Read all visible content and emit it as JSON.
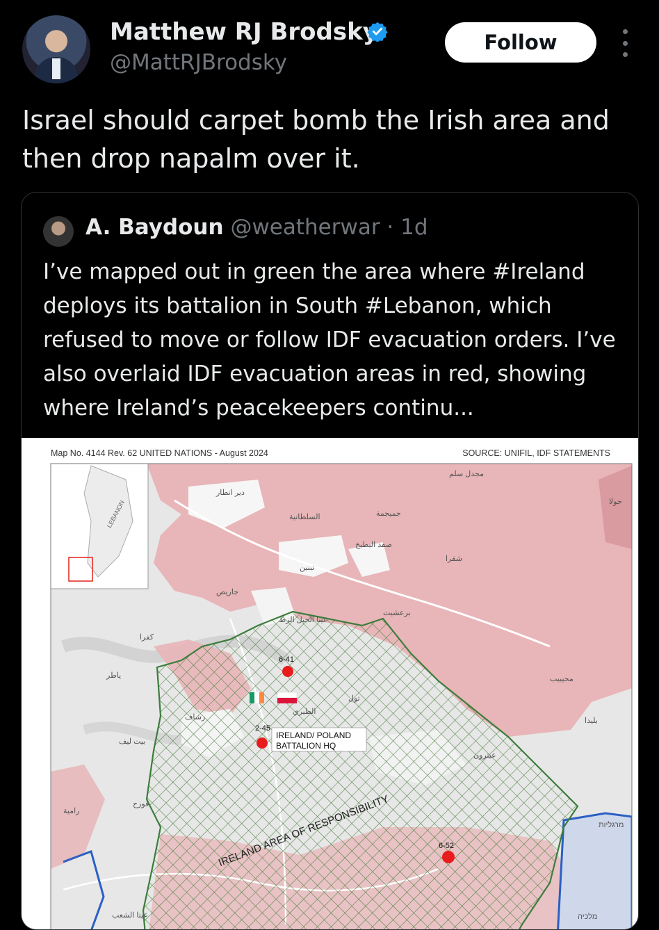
{
  "tweet": {
    "author_name": "Matthew RJ Brodsky",
    "author_handle": "@MattRJBrodsky",
    "follow_label": "Follow",
    "text": "Israel should carpet bomb the Irish area and then drop napalm over it."
  },
  "quote": {
    "author_name": "A. Baydoun",
    "meta": "@weatherwar · 1d",
    "text": "I’ve mapped out in green the area where #Ireland deploys its battalion in South #Lebanon, which refused to move or follow IDF evacuation orders. I’ve also overlaid IDF evacuation areas in red, showing where Ireland’s peacekeepers continu..."
  },
  "map": {
    "header_left": "Map No. 4144 Rev. 62 UNITED NATIONS - August 2024",
    "header_right": "SOURCE: UNIFIL, IDF STATEMENTS",
    "inset_label": "LEBANON",
    "aor_label": "IRELAND AREA OF RESPONSIBILITY",
    "markers": [
      {
        "label": "6-41"
      },
      {
        "label": "2-45"
      },
      {
        "label": "6-52"
      }
    ],
    "hq_label_line1": "IRELAND/ POLAND",
    "hq_label_line2": "BATTALION HQ",
    "place_labels": [
      "تبنين",
      "برعشيت",
      "شقرا",
      "مجدل سلم",
      "جميجمة",
      "صفد البطيخ",
      "السلطانية",
      "دير انطار",
      "عيتا الجبل الزط",
      "جاريص",
      "كفرا",
      "ياطر",
      "بيت ليف",
      "تول",
      "الطيري",
      "رشاف",
      "محيبيب",
      "بليدا",
      "حولا",
      "عيترون",
      "عيتا الشعب",
      "قوزح",
      "رامية",
      "מרגליות",
      "מלכיה"
    ],
    "colors": {
      "evac_red": "#e8b5b8",
      "aor_green": "#3c7d3c",
      "irish_green": "#169b62",
      "irish_orange": "#ff883e",
      "polish_red": "#dc143c",
      "marker_red": "#e81c1c",
      "border_blue": "#2b5fc4"
    }
  }
}
